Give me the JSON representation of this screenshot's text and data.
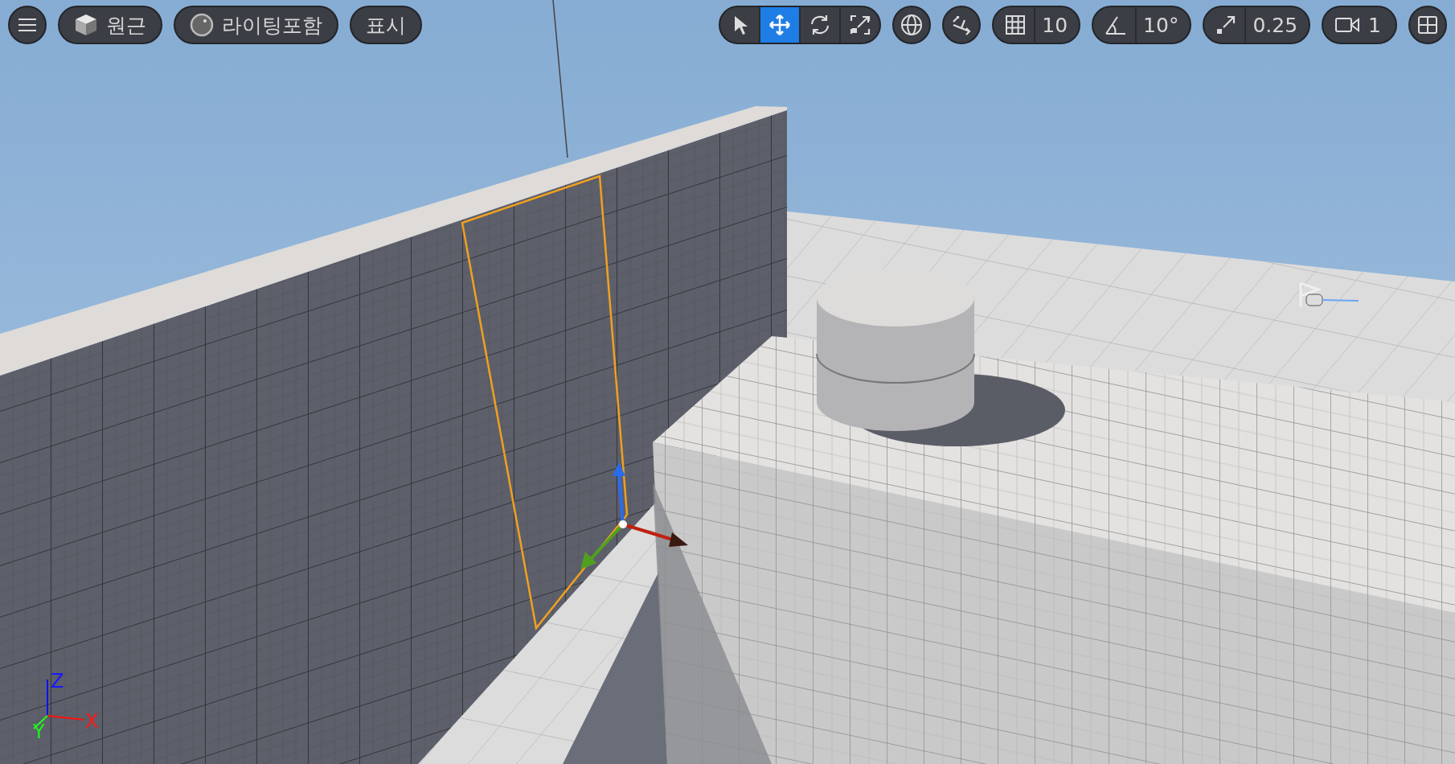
{
  "toolbar_left": [
    {
      "kind": "menu"
    },
    {
      "kind": "view_mode",
      "label": "원근"
    },
    {
      "kind": "lighting",
      "label": "라이팅포함"
    },
    {
      "kind": "show",
      "label": "표시"
    }
  ],
  "transform_tools": [
    {
      "kind": "select",
      "selected": false
    },
    {
      "kind": "move",
      "selected": true
    },
    {
      "kind": "rotate",
      "selected": false
    },
    {
      "kind": "scale",
      "selected": false
    }
  ],
  "snaps": [
    {
      "kind": "grid",
      "value": "10"
    },
    {
      "kind": "angle",
      "value": "10°"
    },
    {
      "kind": "scale",
      "value": "0.25"
    }
  ],
  "camera_speed": "1",
  "axis_indicator": {
    "z": "Z",
    "x": "X",
    "y": "Y"
  }
}
